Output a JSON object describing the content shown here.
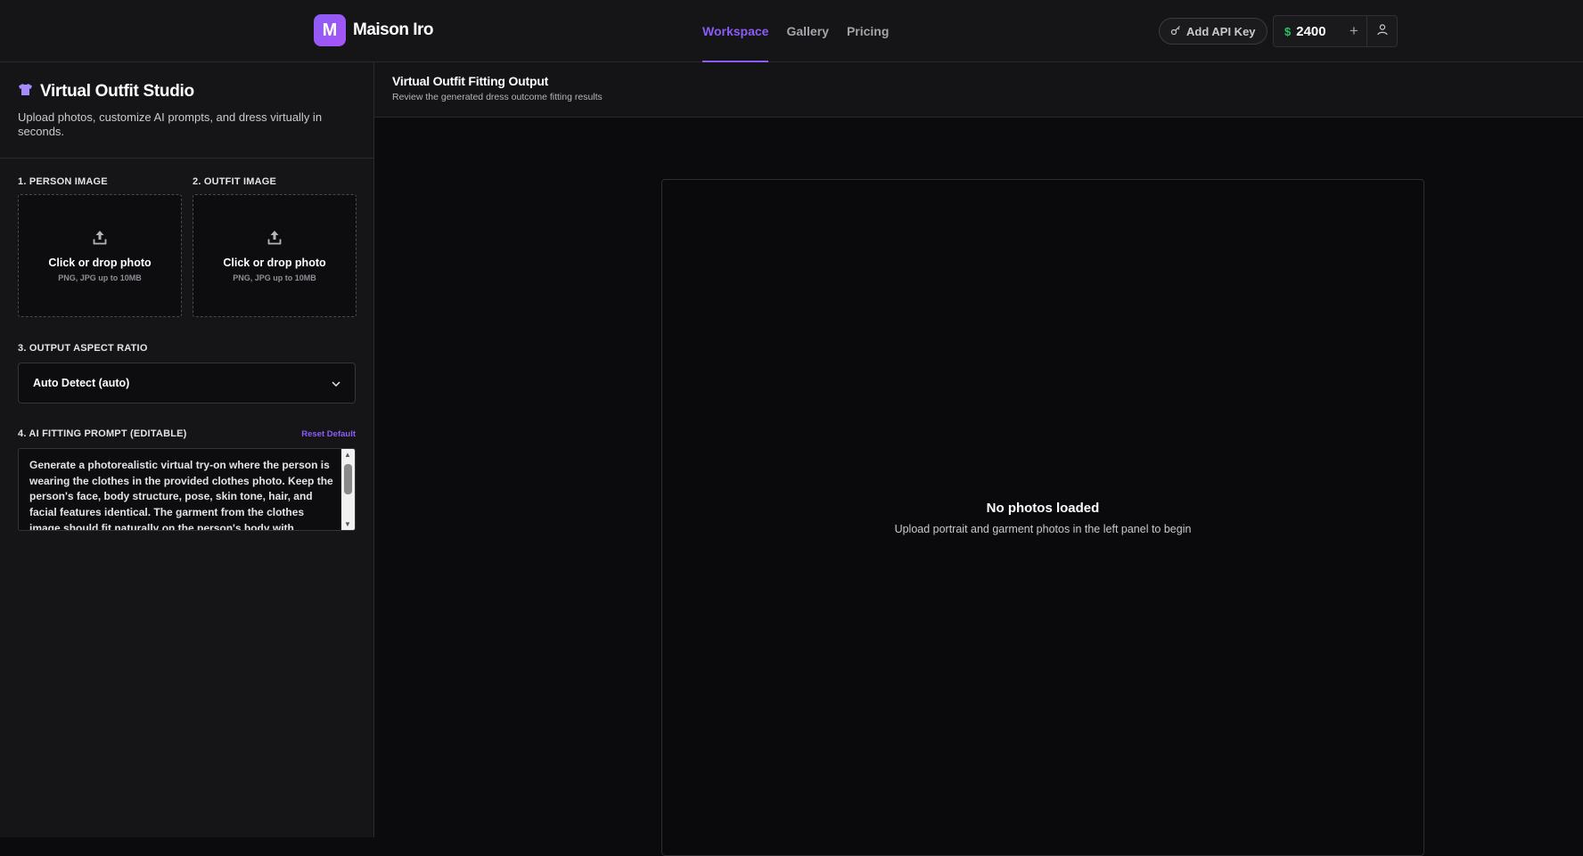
{
  "brand": {
    "logo_letter": "M",
    "name": "Maison Iro"
  },
  "nav": {
    "items": [
      {
        "label": "Workspace",
        "active": true
      },
      {
        "label": "Gallery",
        "active": false
      },
      {
        "label": "Pricing",
        "active": false
      }
    ]
  },
  "header": {
    "api_key_label": "Add API Key",
    "credits": "2400",
    "currency_symbol": "$",
    "plus_symbol": "+"
  },
  "sidebar": {
    "title": "Virtual Outfit Studio",
    "subtitle": "Upload photos, customize AI prompts, and dress virtually in seconds.",
    "person": {
      "label": "1. PERSON IMAGE",
      "drop_title": "Click or drop photo",
      "drop_hint": "PNG, JPG up to 10MB"
    },
    "outfit": {
      "label": "2. OUTFIT IMAGE",
      "drop_title": "Click or drop photo",
      "drop_hint": "PNG, JPG up to 10MB"
    },
    "aspect": {
      "label": "3. OUTPUT ASPECT RATIO",
      "value": "Auto Detect (auto)"
    },
    "prompt": {
      "label": "4. AI FITTING PROMPT (EDITABLE)",
      "reset_label": "Reset Default",
      "text": "Generate a photorealistic virtual try-on where the person is wearing the clothes in the provided clothes photo. Keep the person's face, body structure, pose, skin tone, hair, and facial features identical. The garment from the clothes image should fit naturally on the person's body with"
    }
  },
  "main": {
    "title": "Virtual Outfit Fitting Output",
    "subtitle": "Review the generated dress outcome fitting results",
    "empty_title": "No photos loaded",
    "empty_subtitle": "Upload portrait and garment photos in the left panel to begin"
  },
  "colors": {
    "accent": "#8b5cf6",
    "money": "#22c55e",
    "background": "#0b0b0d",
    "panel": "#151517"
  },
  "icons": [
    "shirt-icon",
    "upload-icon",
    "chevron-down-icon",
    "key-icon",
    "dollar-icon",
    "plus-icon",
    "user-icon"
  ]
}
